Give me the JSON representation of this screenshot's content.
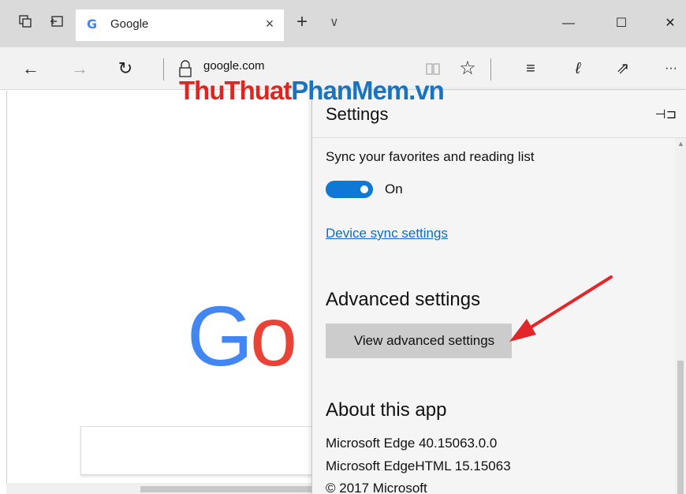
{
  "tabbar": {
    "tab_title": "Google",
    "favicon_letter": "G",
    "new_tab_glyph": "+",
    "close_glyph": "×",
    "tab_list_glyph": "∨",
    "window": {
      "minimize": "—",
      "maximize": "☐",
      "close": "✕"
    }
  },
  "navbar": {
    "url": "google.com",
    "back_glyph": "←",
    "forward_glyph": "→",
    "refresh_glyph": "↻",
    "favorite_glyph": "☆",
    "hub_glyph": "≡",
    "notes_glyph": "ℓ",
    "share_glyph": "⇗",
    "more_glyph": "···"
  },
  "page": {
    "logo_part_1": "G",
    "logo_part_2": "o"
  },
  "settings": {
    "title": "Settings",
    "pin_glyph": "⊣⊐",
    "sync_label": "Sync your favorites and reading list",
    "sync_toggle_on": true,
    "sync_state": "On",
    "device_sync_link": "Device sync settings",
    "advanced_heading": "Advanced settings",
    "view_advanced_button": "View advanced settings",
    "about_heading": "About this app",
    "about_lines": [
      "Microsoft Edge 40.15063.0.0",
      "Microsoft EdgeHTML 15.15063",
      "© 2017 Microsoft"
    ]
  },
  "watermark": {
    "part_1": "ThuThuat",
    "part_2": "PhanMem.vn"
  },
  "colors": {
    "accent": "#0f78d4",
    "link": "#0f6cbd",
    "annotation_arrow": "#e3262a",
    "watermark_red": "#e1241f",
    "watermark_blue": "#1874c1"
  }
}
